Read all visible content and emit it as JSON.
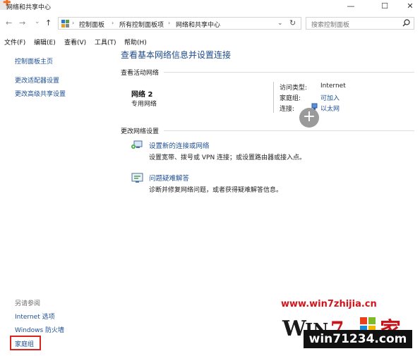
{
  "window": {
    "title": "网络和共享中心",
    "buttons": {
      "minimize": "—",
      "maximize": "☐",
      "close": "✕"
    }
  },
  "nav": {
    "back": "←",
    "forward": "→",
    "recent": "⌄",
    "up": "↑",
    "dropdown": "⌄",
    "refresh": "↻"
  },
  "address": {
    "crumbs": [
      "控制面板",
      "所有控制面板项",
      "网络和共享中心"
    ],
    "sep": "›"
  },
  "search": {
    "placeholder": "搜索控制面板",
    "icon": "search-icon"
  },
  "menu": [
    "文件(F)",
    "编辑(E)",
    "查看(V)",
    "工具(T)",
    "帮助(H)"
  ],
  "left": {
    "links_top": [
      "控制面板主页",
      "更改适配器设置",
      "更改高级共享设置"
    ],
    "see_also": "另请参阅",
    "links_bottom": [
      "Internet 选项",
      "Windows 防火墙",
      "家庭组"
    ],
    "highlight_color": "#d9231d"
  },
  "main": {
    "title": "查看基本网络信息并设置连接",
    "active_head": "查看活动网络",
    "network": {
      "name": "网络  2",
      "type": "专用网络"
    },
    "props": [
      {
        "label": "访问类型:",
        "value": "Internet"
      },
      {
        "label": "家庭组:",
        "value": "可加入"
      },
      {
        "label": "连接:",
        "value": "以太网"
      }
    ],
    "change_head": "更改网络设置",
    "tasks": [
      {
        "link": "设置新的连接或网络",
        "desc": "设置宽带、拨号或 VPN 连接；或设置路由器或接入点。",
        "icon": "network-setup-icon"
      },
      {
        "link": "问题疑难解答",
        "desc": "诊断并修复网络问题，或者获得疑难解答信息。",
        "icon": "troubleshoot-icon"
      }
    ]
  },
  "watermark": {
    "url": "www.win7zhijia.cn",
    "text": "win71234.com",
    "logo": "Win7 家"
  }
}
